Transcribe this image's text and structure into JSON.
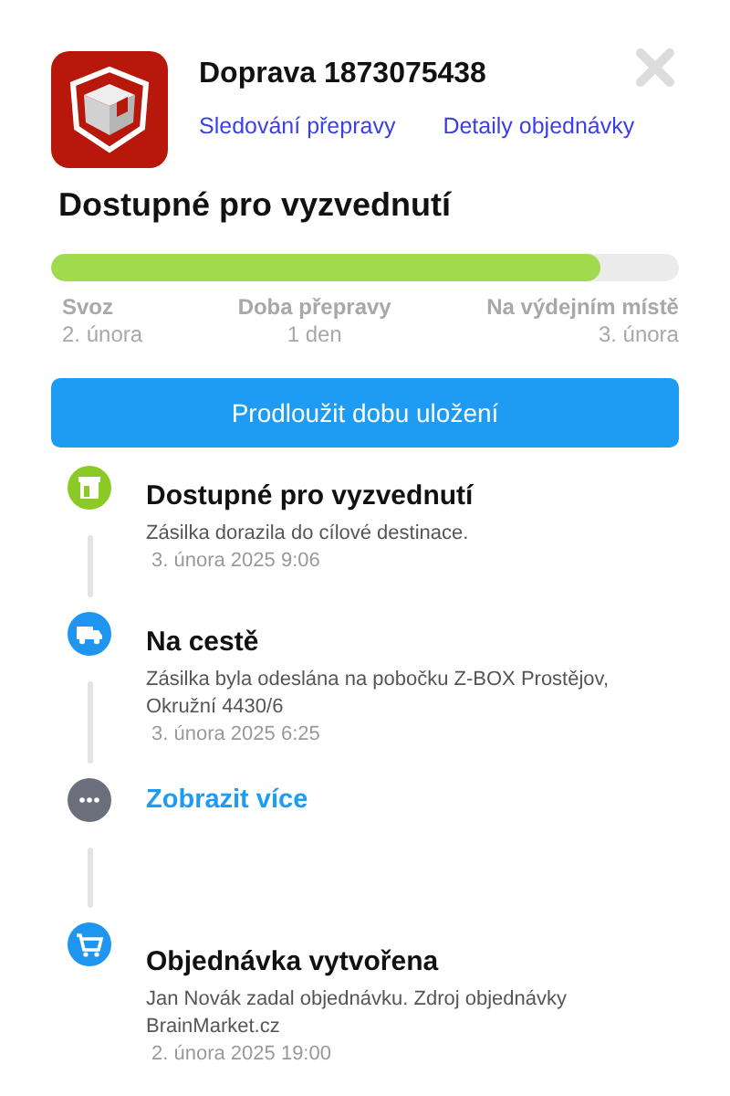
{
  "header": {
    "title": "Doprava 1873075438",
    "links": [
      "Sledování přepravy",
      "Detaily objednávky"
    ]
  },
  "status": {
    "title": "Dostupné pro vyzvednutí",
    "level": 0.875
  },
  "milestones": [
    {
      "label": "Svoz",
      "value": "2. února"
    },
    {
      "label": "Doba přepravy",
      "value": "1 den"
    },
    {
      "label": "Na výdejním místě",
      "value": "3. února"
    }
  ],
  "action_button": "Prodloužit dobu uložení",
  "timeline": [
    {
      "kind": "pickup",
      "color": "#8bc926",
      "title": "Dostupné pro vyzvednutí",
      "description": "Zásilka dorazila do cílové destinace.",
      "date": "3. února 2025 9:06"
    },
    {
      "kind": "transit",
      "color": "#1e96f0",
      "title": "Na cestě",
      "description": "Zásilka byla odeslána na pobočku Z-BOX Prostějov, Okružní 4430/6",
      "date": "3. února 2025 6:25"
    },
    {
      "kind": "more",
      "color": "#6b6e7b",
      "title": "Zobrazit více"
    },
    {
      "kind": "order",
      "color": "#1e96f0",
      "title": "Objednávka vytvořena",
      "description": "Jan Novák zadal objednávku. Zdroj objednávky BrainMarket.cz",
      "date": "2. února 2025 19:00"
    }
  ]
}
